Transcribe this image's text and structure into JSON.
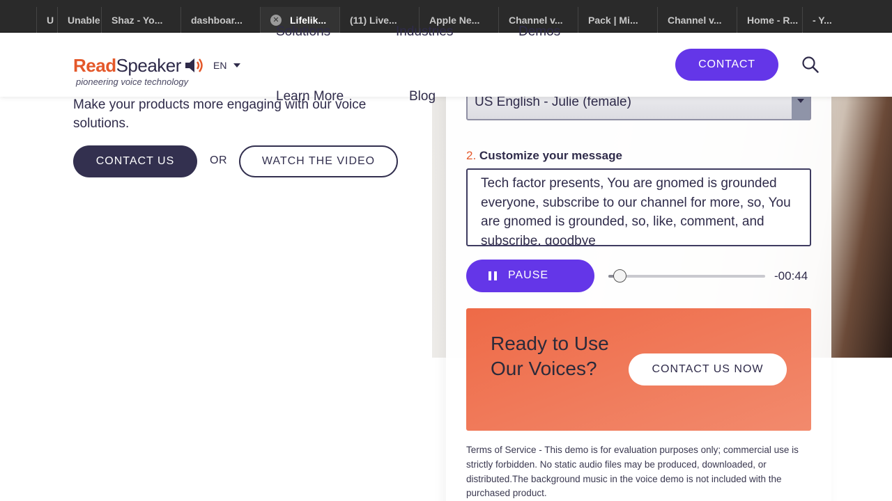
{
  "browser": {
    "tabs": [
      {
        "label": "U",
        "active": false
      },
      {
        "label": "Unable",
        "active": false
      },
      {
        "label": "Shaz - Yo...",
        "active": false
      },
      {
        "label": "dashboar...",
        "active": false
      },
      {
        "label": "Lifelik...",
        "active": true
      },
      {
        "label": "(11) Live...",
        "active": false
      },
      {
        "label": "Apple Ne...",
        "active": false
      },
      {
        "label": "Channel v...",
        "active": false
      },
      {
        "label": "Pack | Mi...",
        "active": false
      },
      {
        "label": "Channel v...",
        "active": false
      },
      {
        "label": "Home - R...",
        "active": false
      },
      {
        "label": "- Y...",
        "active": false
      }
    ],
    "close_glyph": "✕"
  },
  "header": {
    "logo_read": "Read",
    "logo_speaker": "Speaker",
    "tagline": "pioneering voice technology",
    "language": "EN",
    "nav": {
      "solutions": "Solutions",
      "industries": "Industries",
      "demos": "Demos",
      "learn_more": "Learn More",
      "blog": "Blog"
    },
    "contact_label": "CONTACT",
    "search_icon": "search-icon"
  },
  "hero": {
    "description": "Make your products more engaging with our voice solutions.",
    "contact_us_label": "CONTACT US",
    "or_label": "OR",
    "watch_label": "WATCH THE VIDEO"
  },
  "demo": {
    "voice_selected": "US English - Julie (female)",
    "step2_number": "2.",
    "step2_label": "Customize your message",
    "message": "Tech factor presents, You are gnomed is grounded everyone, subscribe to our channel for more, so, You are gnomed is grounded, so, like, comment, and subscribe, goodbye",
    "pause_label": "PAUSE",
    "playback_progress": 0.07,
    "time_remaining": "-00:44"
  },
  "cta": {
    "title": "Ready to Use Our Voices?",
    "button_label": "CONTACT US NOW"
  },
  "terms": "Terms of Service - This demo is for evaluation purposes only; commercial use is strictly forbidden. No static audio files may be produced, downloaded, or distributed.The background music in the voice demo is not included with the purchased product.",
  "colors": {
    "brand_orange": "#e4582a",
    "brand_purple": "#6436e8",
    "navy": "#33304f",
    "cta_orange": "#ee6a47"
  }
}
